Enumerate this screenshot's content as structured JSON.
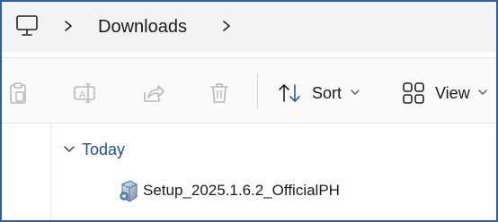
{
  "address_bar": {
    "root_icon": "computer-icon",
    "breadcrumb": [
      "Downloads"
    ],
    "separator_icon": "chevron-right-icon"
  },
  "toolbar": {
    "paste_icon": "paste-icon",
    "rename_icon": "rename-icon",
    "share_icon": "share-icon",
    "delete_icon": "delete-icon",
    "sort_label": "Sort",
    "sort_icon": "sort-icon",
    "view_label": "View",
    "view_icon": "view-icon"
  },
  "content": {
    "groups": [
      {
        "title": "Today",
        "expanded": true,
        "files": [
          {
            "name": "Setup_2025.1.6.2_OfficialPH",
            "icon": "installer-file-icon"
          }
        ]
      }
    ]
  },
  "colors": {
    "frame_border": "#2f5ea8",
    "group_title": "#1f4e8c",
    "address_bar_bg": "#f3f3f3"
  }
}
